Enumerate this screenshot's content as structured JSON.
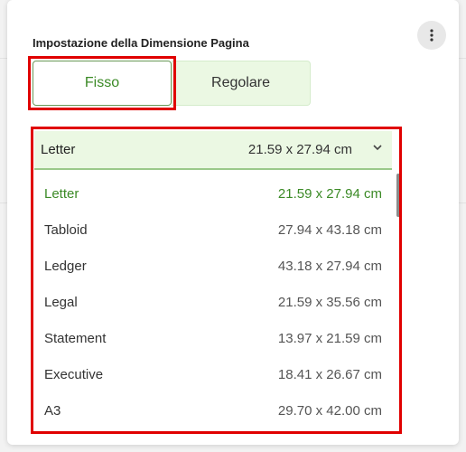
{
  "panel": {
    "title": "Impostazione della Dimensione Pagina",
    "menu_icon": "more-vertical-icon"
  },
  "segmented": {
    "options": [
      {
        "label": "Fisso",
        "selected": true
      },
      {
        "label": "Regolare",
        "selected": false
      }
    ]
  },
  "dropdown": {
    "selected": {
      "name": "Letter",
      "dimensions": "21.59 x 27.94 cm"
    },
    "chevron_icon": "chevron-down-icon",
    "items": [
      {
        "name": "Letter",
        "dimensions": "21.59 x 27.94 cm",
        "selected": true
      },
      {
        "name": "Tabloid",
        "dimensions": "27.94 x 43.18 cm",
        "selected": false
      },
      {
        "name": "Ledger",
        "dimensions": "43.18 x 27.94 cm",
        "selected": false
      },
      {
        "name": "Legal",
        "dimensions": "21.59 x 35.56 cm",
        "selected": false
      },
      {
        "name": "Statement",
        "dimensions": "13.97 x 21.59 cm",
        "selected": false
      },
      {
        "name": "Executive",
        "dimensions": "18.41 x 26.67 cm",
        "selected": false
      },
      {
        "name": "A3",
        "dimensions": "29.70 x 42.00 cm",
        "selected": false
      }
    ]
  },
  "colors": {
    "accent_green": "#3b8a26",
    "selected_bg": "#ebf8e3",
    "highlight_red": "#e00000"
  }
}
